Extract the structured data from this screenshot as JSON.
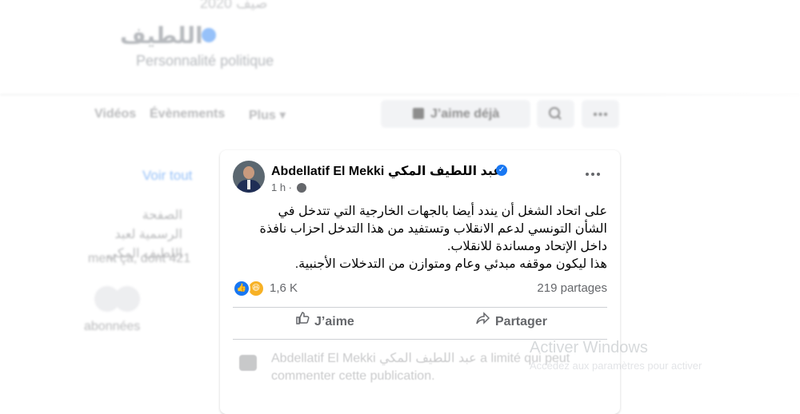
{
  "background": {
    "top_blurred": "صيف 2020",
    "page_name": "اللطيف",
    "page_category": "Personnalité politique",
    "nav": {
      "videos": "Vidéos",
      "events": "Évènements",
      "more": "Plus ▾",
      "like_button": "J’aime déjà"
    },
    "left_panel": {
      "see_all": "Voir tout",
      "official_page": "الصفحة الرسمية لعبد اللطيف المكي",
      "likes_count": "ment ça, dont 421",
      "subscribers": "abonnées"
    }
  },
  "post": {
    "author": "Abdellatif El Mekki عبد اللطيف المكي",
    "time": "1 h ·",
    "lines": [
      "على اتحاد الشغل أن يندد أيضا  بالجهات الخارجية التي تتدخل في",
      "الشأن التونسي لدعم الانقلاب وتستفيد من هذا التدخل احزاب نافذة",
      "داخل الإتحاد ومساندة للانقلاب.",
      "هذا ليكون موقفه مبدئي وعام ومتوازن من التدخلات الأجنبية."
    ],
    "reactions_count": "1,6 K",
    "shares": "219 partages",
    "like_action": "J’aime",
    "share_action": "Partager",
    "restriction_notice": "Abdellatif El Mekki عبد اللطيف المكي a limité qui peut commenter cette publication."
  },
  "overlay": {
    "windows_watermark": "Activer Windows",
    "windows_watermark_sub": "Accédez aux paramètres pour activer"
  },
  "colors": {
    "accent": "#1877f2",
    "muted_text": "#65676b",
    "button_bg": "#e4e6eb"
  }
}
